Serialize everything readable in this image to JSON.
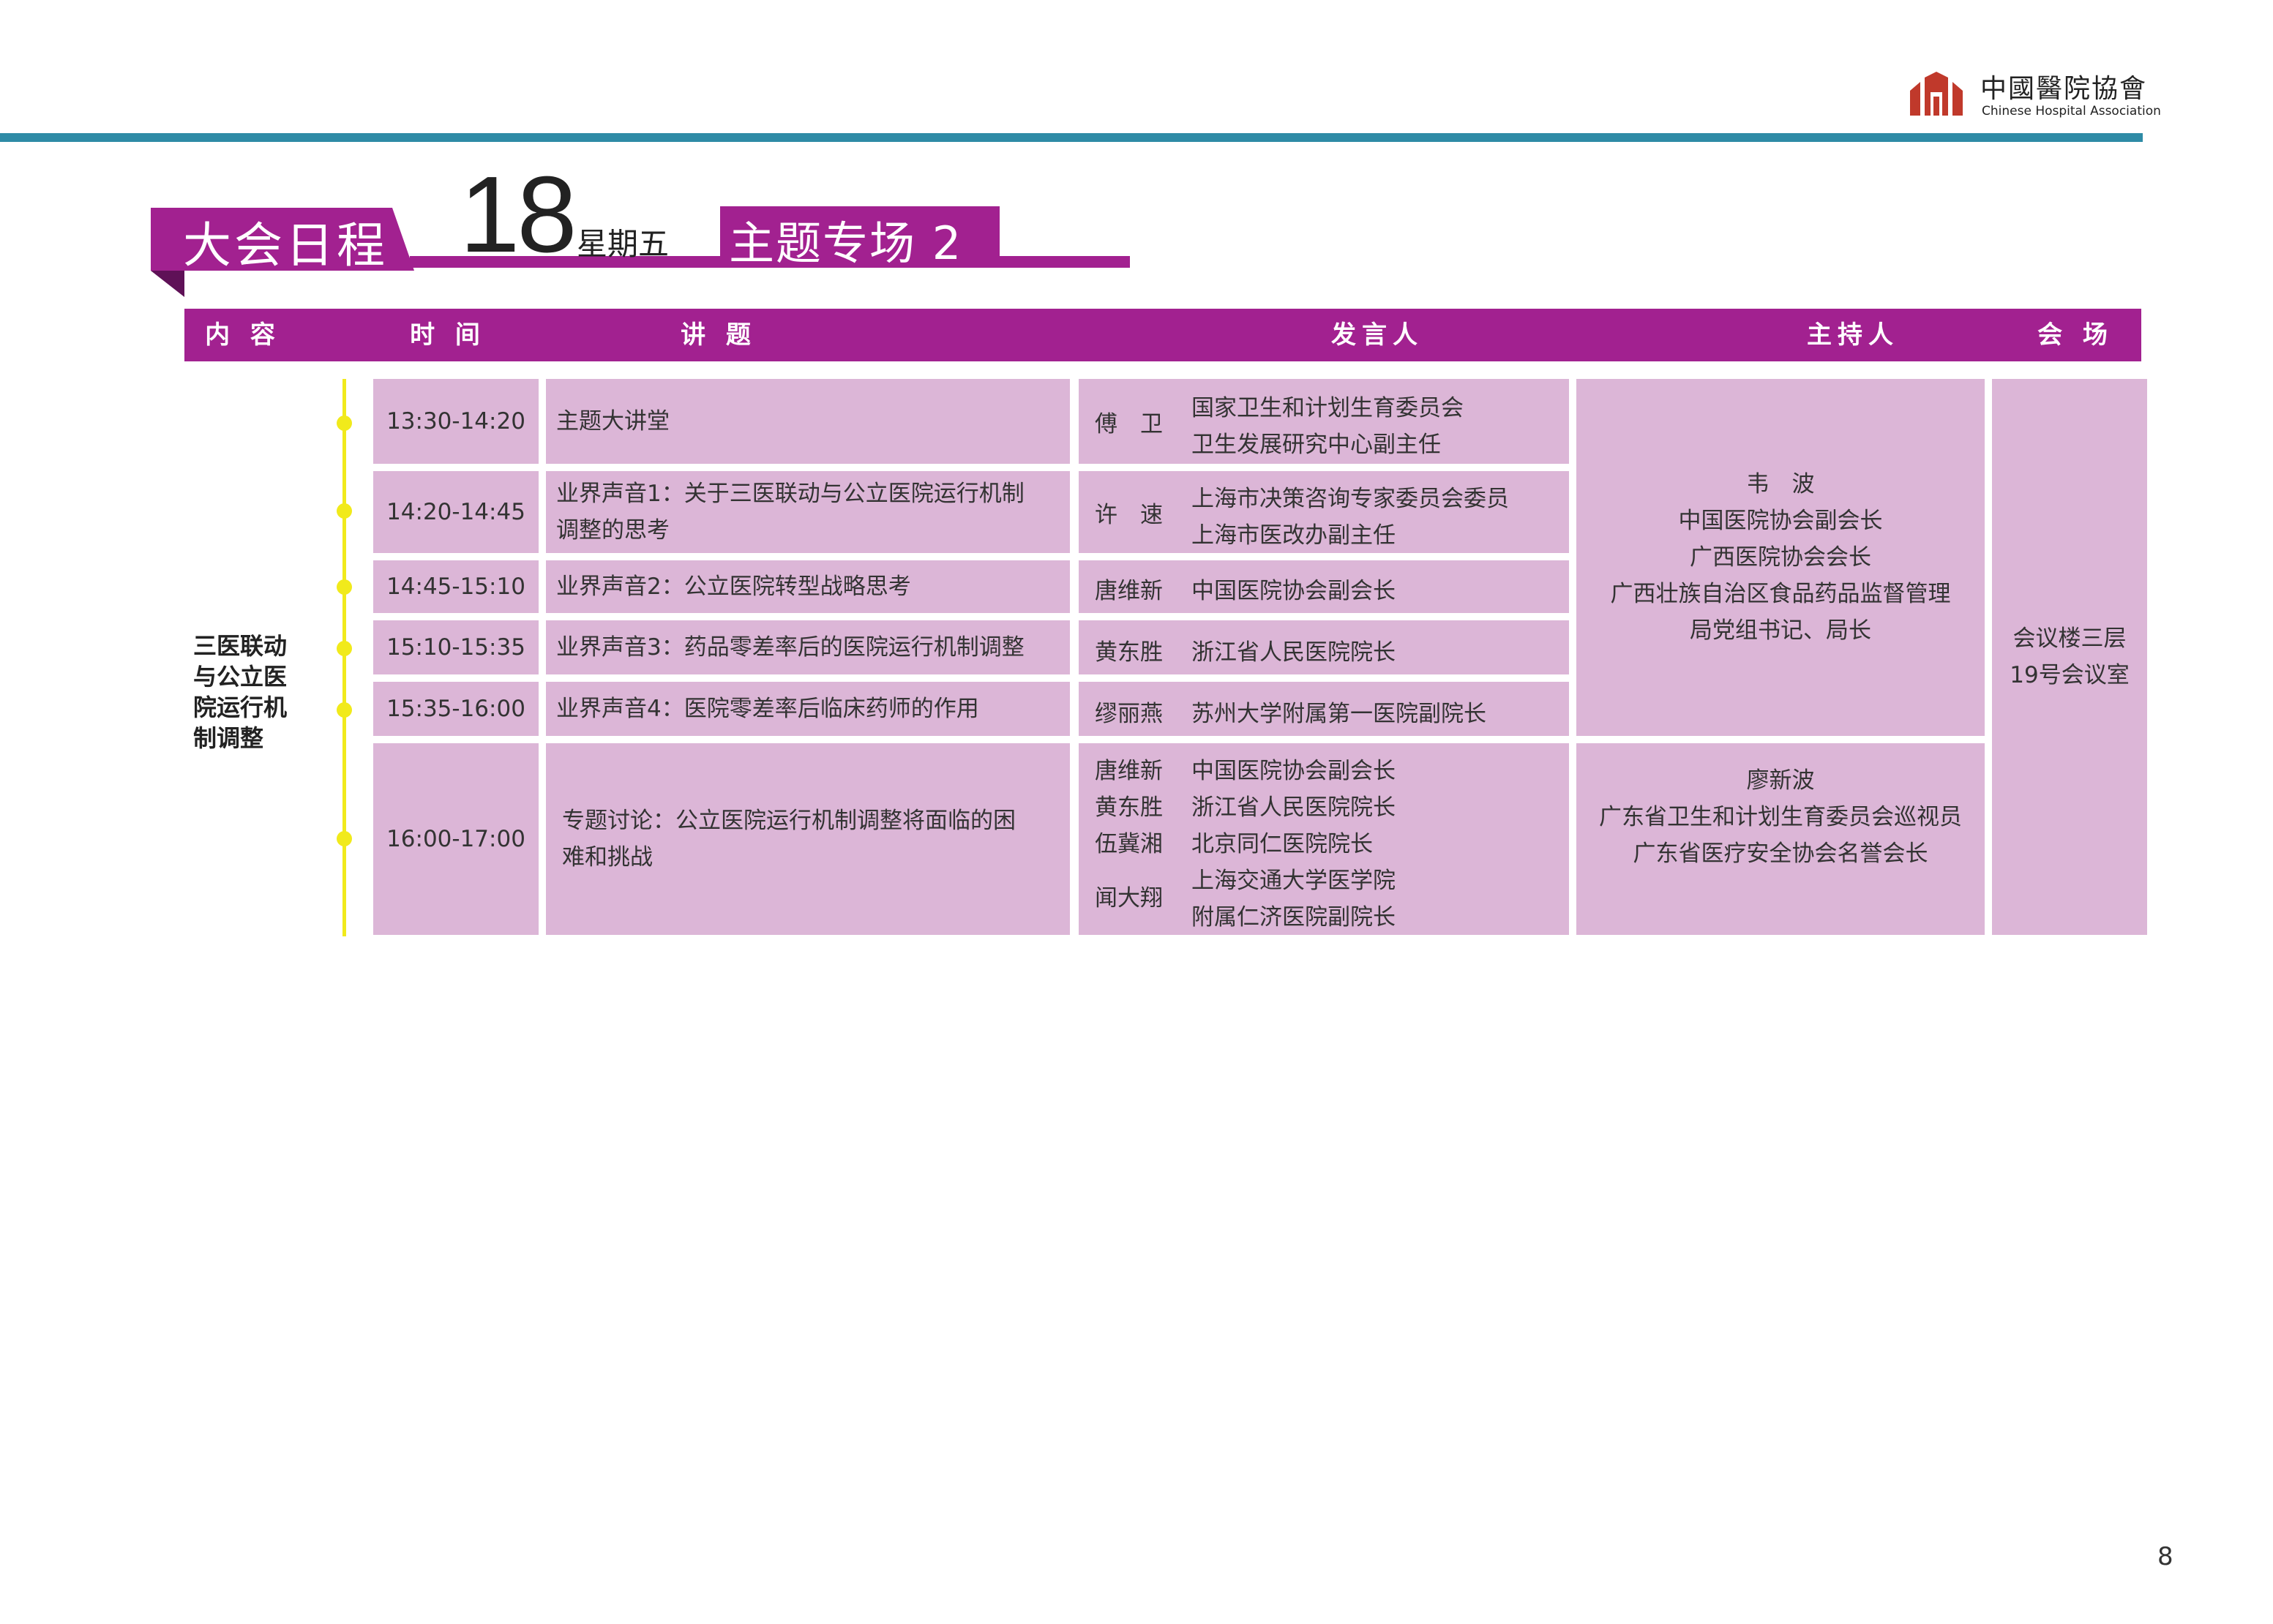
{
  "logo": {
    "cn_name": "中國醫院協會",
    "en_name": "Chinese Hospital Association"
  },
  "banner": {
    "title": "大会日程",
    "day": "18",
    "weekday": "星期五",
    "topic": "主题专场 2"
  },
  "table": {
    "headers": [
      "内 容",
      "时 间",
      "讲 题",
      "发言人",
      "主持人",
      "会 场"
    ],
    "topic": "三医联动与公立医院运行机制调整",
    "rows": [
      {
        "time": "13:30-14:20",
        "title_lines": [
          "主题大讲堂"
        ],
        "speakers": [
          {
            "name": "傅　卫",
            "titles": [
              "国家卫生和计划生育委员会",
              "卫生发展研究中心副主任"
            ]
          }
        ]
      },
      {
        "time": "14:20-14:45",
        "title_lines": [
          "业界声音1：关于三医联动与公立医院运行机制",
          "调整的思考"
        ],
        "speakers": [
          {
            "name": "许　速",
            "titles": [
              "上海市决策咨询专家委员会委员",
              "上海市医改办副主任"
            ]
          }
        ]
      },
      {
        "time": "14:45-15:10",
        "title_lines": [
          "业界声音2：公立医院转型战略思考"
        ],
        "speakers": [
          {
            "name": "唐维新",
            "titles": [
              "中国医院协会副会长"
            ]
          }
        ]
      },
      {
        "time": "15:10-15:35",
        "title_lines": [
          "业界声音3：药品零差率后的医院运行机制调整"
        ],
        "speakers": [
          {
            "name": "黄东胜",
            "titles": [
              "浙江省人民医院院长"
            ]
          }
        ]
      },
      {
        "time": "15:35-16:00",
        "title_lines": [
          "业界声音4：医院零差率后临床药师的作用"
        ],
        "speakers": [
          {
            "name": "缪丽燕",
            "titles": [
              "苏州大学附属第一医院副院长"
            ]
          }
        ]
      },
      {
        "time": "16:00-17:00",
        "title_lines": [
          "专题讨论：公立医院运行机制调整将面临的困",
          "难和挑战"
        ],
        "speakers": [
          {
            "name": "唐维新",
            "titles": [
              "中国医院协会副会长"
            ]
          },
          {
            "name": "黄东胜",
            "titles": [
              "浙江省人民医院院长"
            ]
          },
          {
            "name": "伍冀湘",
            "titles": [
              "北京同仁医院院长"
            ]
          },
          {
            "name": "闻大翔",
            "titles": [
              "上海交通大学医学院",
              "附属仁济医院副院长"
            ]
          }
        ]
      }
    ],
    "hosts": [
      {
        "lines": [
          "韦　波",
          "中国医院协会副会长",
          "广西医院协会会长",
          "广西壮族自治区食品药品监督管理",
          "局党组书记、局长"
        ]
      },
      {
        "lines": [
          "廖新波",
          "广东省卫生和计划生育委员会巡视员",
          "广东省医疗安全协会名誉会长"
        ]
      }
    ],
    "venue_lines": [
      "会议楼三层",
      "19号会议室"
    ]
  },
  "page_number": "8",
  "colors": {
    "accent": "#a22190",
    "cell": "#dcb6d7",
    "rule": "#2e8ba6",
    "timeline": "#f1ea1b"
  }
}
